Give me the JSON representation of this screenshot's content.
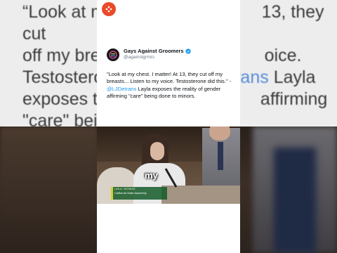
{
  "background_text": {
    "line1": "“Look at my",
    "line1_right": "13, they cut",
    "line2": "off my brea",
    "line2_right": "oice.",
    "line3": "Testosterone",
    "line3_hl": "trans",
    "line3_right": "Layla",
    "line4": "exposes th",
    "line4_right": "affirming",
    "line5": "\"care\" being"
  },
  "tweet": {
    "display_name": "Gays Against Groomers",
    "handle": "@againstgrmrs",
    "text_before": "\"Look at my chest. I matter! At 13, they cut off my breasts... Listen to my voice. Testosterone did this.\" - ",
    "mention": "@LJDetrans",
    "text_after": " Layla exposes the reality of gender affirming \"care\" being done to minors."
  },
  "video": {
    "caption_word": "my",
    "lower_third_top": "LAYLA · WITNESS",
    "lower_third_bottom": "California State Assembly"
  },
  "colors": {
    "channel_badge": "#e94a2a",
    "verified": "#1d9bf0",
    "mention": "#1d9bf0"
  },
  "icons": {
    "channel": "channel-avatar-icon",
    "avatar": "account-logo-icon",
    "verified": "verified-badge-icon"
  }
}
